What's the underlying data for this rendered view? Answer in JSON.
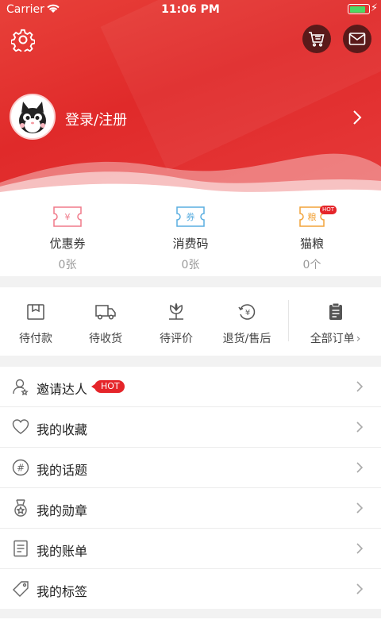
{
  "status_bar": {
    "carrier": "Carrier",
    "time": "11:06 PM",
    "battery_level": 0.9
  },
  "header": {
    "login_label": "登录/注册"
  },
  "stats": [
    {
      "label": "优惠券",
      "value": "0张",
      "icon": "coupon-icon",
      "icon_text": "¥"
    },
    {
      "label": "消费码",
      "value": "0张",
      "icon": "voucher-icon",
      "icon_text": "券"
    },
    {
      "label": "猫粮",
      "value": "0个",
      "icon": "cat-food-icon",
      "icon_text": "粮",
      "badge": "HOT"
    }
  ],
  "orders": {
    "items": [
      {
        "label": "待付款",
        "icon": "pending-payment-icon"
      },
      {
        "label": "待收货",
        "icon": "truck-icon"
      },
      {
        "label": "待评价",
        "icon": "review-icon"
      },
      {
        "label": "退货/售后",
        "icon": "refund-icon"
      }
    ],
    "all_label": "全部订单",
    "all_refund_symbol": "¥"
  },
  "menu": [
    {
      "label": "邀请达人",
      "icon": "invite-user-icon",
      "badge": "HOT"
    },
    {
      "label": "我的收藏",
      "icon": "heart-icon"
    },
    {
      "label": "我的话题",
      "icon": "hashtag-icon",
      "icon_text": "#"
    },
    {
      "label": "我的勋章",
      "icon": "medal-icon"
    },
    {
      "label": "我的账单",
      "icon": "bill-icon"
    },
    {
      "label": "我的标签",
      "icon": "tag-icon"
    }
  ],
  "colors": {
    "brand_red": "#e5252a",
    "header_red": "#e8413a",
    "coupon_pink": "#f07a8a",
    "voucher_blue": "#5aaee0",
    "cat_food_orange": "#f2a33a"
  }
}
